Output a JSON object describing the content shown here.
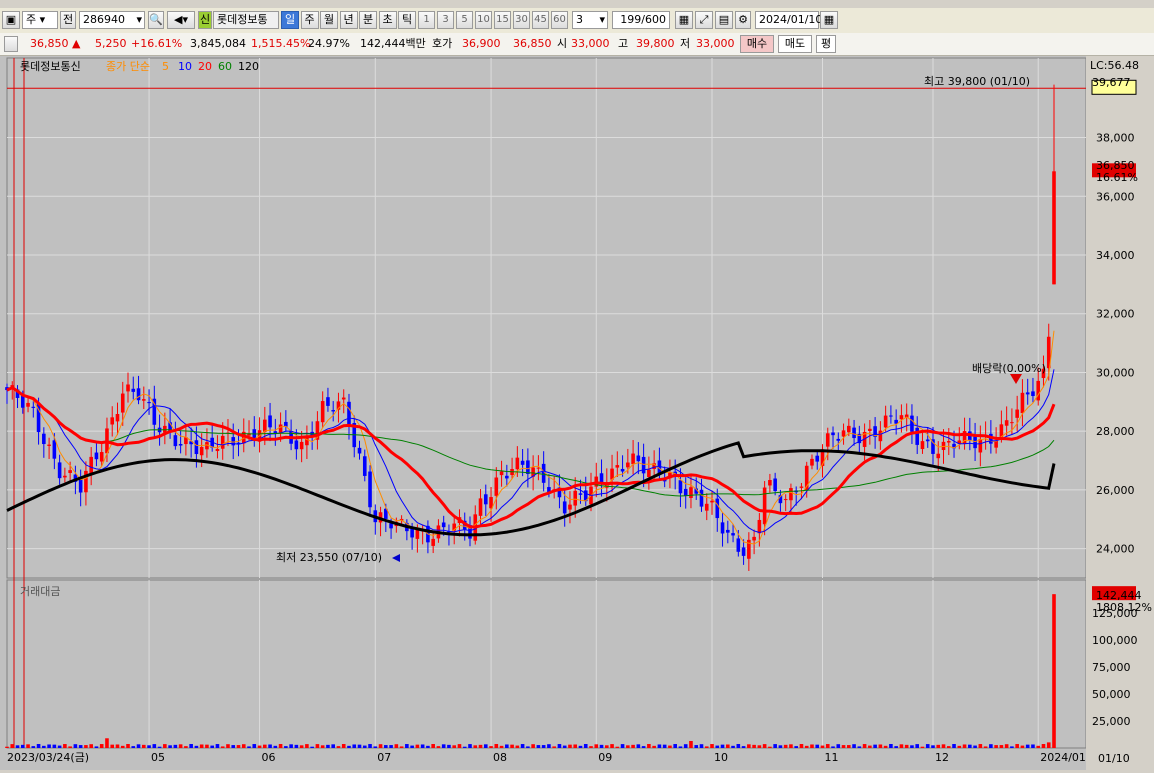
{
  "toolbar": {
    "period_type": "주",
    "prev_label": "전",
    "code": "286940",
    "name_badge": "신",
    "stock_name": "롯데정보통",
    "period_tabs": [
      "일",
      "주",
      "월",
      "년",
      "분",
      "초",
      "틱"
    ],
    "active_tab": "일",
    "interval_buttons": [
      "1",
      "3",
      "5",
      "10",
      "15",
      "30",
      "45",
      "60"
    ],
    "interval_value": "3",
    "count": "199/600",
    "date": "2024/01/10"
  },
  "quote": {
    "price": "36,850",
    "change": "5,250",
    "change_pct": "+16.61%",
    "volume": "3,845,084",
    "volume_ratio": "1,515.45%",
    "turnover": "24.97%",
    "amount": "142,444백만",
    "ask_label": "호가",
    "ask1": "36,900",
    "bid1": "36,850",
    "open_label": "시",
    "open": "33,000",
    "high_label": "고",
    "high": "39,800",
    "low_label": "저",
    "low": "33,000",
    "buy_label": "매수",
    "sell_label": "매도",
    "eval_label": "평"
  },
  "chart_data": {
    "type": "candlestick",
    "title": "롯데정보통신",
    "legend": {
      "prefix": "종가 단순",
      "periods": [
        "5",
        "10",
        "20",
        "60",
        "120"
      ],
      "colors": [
        "#ff8c00",
        "#0000ff",
        "#ff0000",
        "#008000",
        "#000000"
      ]
    },
    "lc_label": "LC:56.48",
    "price_axis": {
      "ticks": [
        "24,000",
        "26,000",
        "28,000",
        "30,000",
        "32,000",
        "34,000",
        "36,000",
        "38,000"
      ],
      "ylim": [
        23000,
        40300
      ]
    },
    "last_price": "36,850",
    "last_change_pct": "16.61%",
    "cross_price": "39,677",
    "high_annotation": "최고 39,800 (01/10)",
    "low_annotation": "최저 23,550 (07/10)",
    "event_annotation": "배당락(0.00%)",
    "x_axis": {
      "start_label": "2023/03/24(금)",
      "months": [
        "05",
        "06",
        "07",
        "08",
        "09",
        "10",
        "11",
        "12",
        "2024/01"
      ],
      "right_label": "01/10"
    },
    "volume_panel": {
      "title": "거래대금",
      "last_value": "142,444",
      "last_ratio": "1808.12%",
      "ticks": [
        "25,000",
        "50,000",
        "75,000",
        "100,000",
        "125,000"
      ],
      "ylim": [
        0,
        150000
      ]
    },
    "anchors": [
      [
        0,
        29400
      ],
      [
        5,
        28500
      ],
      [
        10,
        26800
      ],
      [
        14,
        26000
      ],
      [
        18,
        27500
      ],
      [
        22,
        29500
      ],
      [
        25,
        29200
      ],
      [
        28,
        28200
      ],
      [
        33,
        27800
      ],
      [
        38,
        27200
      ],
      [
        42,
        27800
      ],
      [
        47,
        28000
      ],
      [
        52,
        28000
      ],
      [
        56,
        27600
      ],
      [
        60,
        28700
      ],
      [
        64,
        28800
      ],
      [
        67,
        27200
      ],
      [
        70,
        25100
      ],
      [
        75,
        24600
      ],
      [
        80,
        24600
      ],
      [
        85,
        24700
      ],
      [
        88,
        24500
      ],
      [
        90,
        25600
      ],
      [
        94,
        26600
      ],
      [
        98,
        26700
      ],
      [
        102,
        26500
      ],
      [
        106,
        25500
      ],
      [
        110,
        25700
      ],
      [
        114,
        26600
      ],
      [
        118,
        27100
      ],
      [
        122,
        26500
      ],
      [
        126,
        26600
      ],
      [
        130,
        25900
      ],
      [
        134,
        25200
      ],
      [
        137,
        24500
      ],
      [
        140,
        24100
      ],
      [
        142,
        24300
      ],
      [
        144,
        26000
      ],
      [
        146,
        25800
      ],
      [
        148,
        25600
      ],
      [
        152,
        26800
      ],
      [
        155,
        27400
      ],
      [
        159,
        27900
      ],
      [
        163,
        28000
      ],
      [
        167,
        28200
      ],
      [
        170,
        28400
      ],
      [
        174,
        27700
      ],
      [
        178,
        27400
      ],
      [
        182,
        27600
      ],
      [
        186,
        27800
      ],
      [
        190,
        28200
      ],
      [
        194,
        29100
      ],
      [
        197,
        30000
      ],
      [
        198,
        31500
      ]
    ],
    "last_candle": {
      "open": 33000,
      "high": 39800,
      "low": 33000,
      "close": 36850
    },
    "ma5_points": [],
    "ma20_last": 29400,
    "ma60_last": 28000,
    "ma120_last": 26900
  }
}
